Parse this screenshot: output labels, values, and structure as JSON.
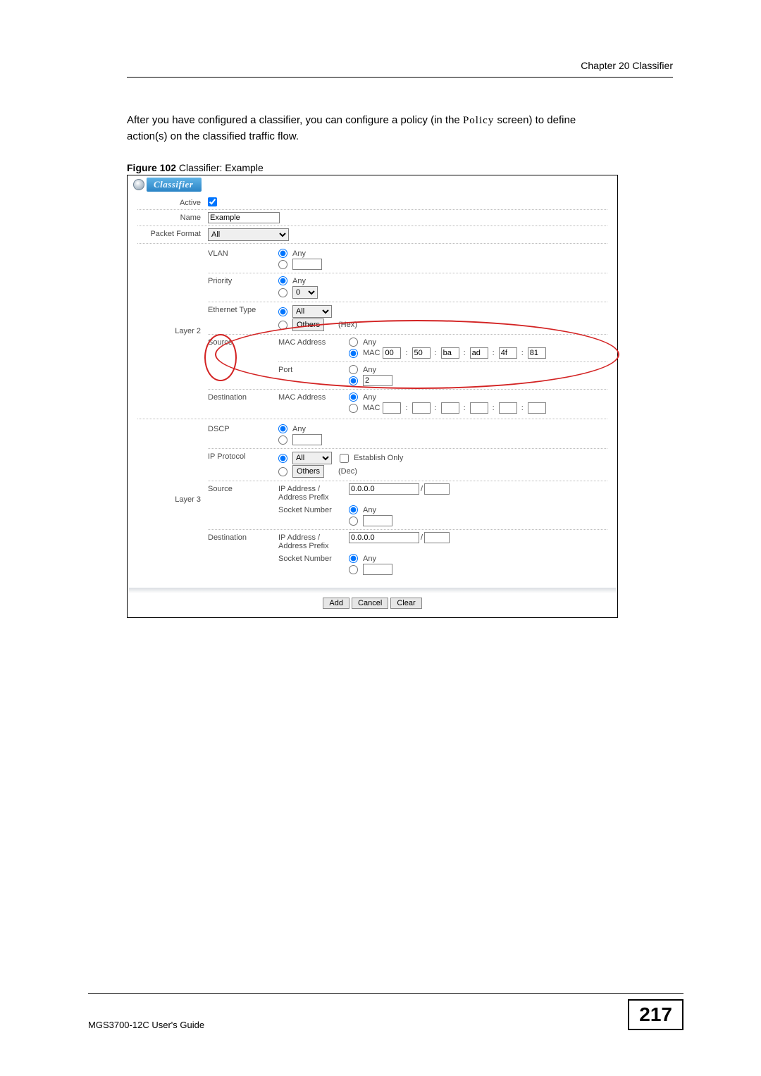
{
  "page": {
    "chapter_header": "Chapter 20 Classifier",
    "body_text_1": "After you have configured a classifier, you can configure a policy (in the ",
    "body_text_policy": "Policy",
    "body_text_2": " screen) to define action(s) on the classified traffic flow.",
    "figure_label": "Figure 102",
    "figure_title": "   Classifier: Example",
    "footer_left": "MGS3700-12C User's Guide",
    "page_number": "217"
  },
  "ui": {
    "tab": "Classifier",
    "labels": {
      "active": "Active",
      "name": "Name",
      "packet_format": "Packet Format",
      "layer2": "Layer 2",
      "layer3": "Layer 3",
      "vlan": "VLAN",
      "priority": "Priority",
      "ethernet_type": "Ethernet Type",
      "source": "Source",
      "destination": "Destination",
      "mac_address": "MAC Address",
      "port": "Port",
      "dscp": "DSCP",
      "ip_protocol": "IP Protocol",
      "ip_addr_prefix": "IP Address /\nAddress Prefix",
      "socket": "Socket Number",
      "any": "Any",
      "mac": "MAC",
      "all": "All",
      "others": "Others",
      "hex": "(Hex)",
      "dec": "(Dec)",
      "establish_only": "Establish Only"
    },
    "values": {
      "name": "Example",
      "packet_format": "All",
      "priority_sel": "0",
      "eth_type": "All",
      "mac1": "00",
      "mac2": "50",
      "mac3": "ba",
      "mac4": "ad",
      "mac5": "4f",
      "mac6": "81",
      "src_port": "2",
      "ip_proto": "All",
      "src_ip": "0.0.0.0",
      "dst_ip": "0.0.0.0"
    },
    "buttons": {
      "add": "Add",
      "cancel": "Cancel",
      "clear": "Clear"
    }
  }
}
